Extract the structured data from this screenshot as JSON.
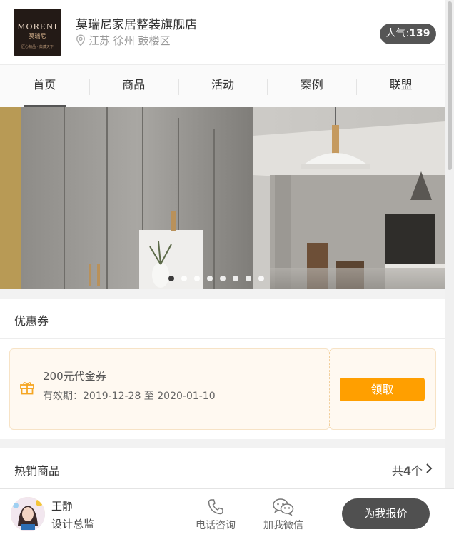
{
  "store": {
    "name": "莫瑞尼家居整装旗舰店",
    "location": "江苏 徐州 鼓楼区",
    "popularity_label": "人气:",
    "popularity_value": "139",
    "logo": {
      "brand": "MORENI",
      "cn": "莫瑞尼",
      "tagline": "匠心精品 · 典藏天下"
    }
  },
  "tabs": [
    {
      "label": "首页",
      "active": true
    },
    {
      "label": "商品",
      "active": false
    },
    {
      "label": "活动",
      "active": false
    },
    {
      "label": "案例",
      "active": false
    },
    {
      "label": "联盟",
      "active": false
    }
  ],
  "banner": {
    "slide_count": 8,
    "active_index": 0
  },
  "coupon_section": {
    "title": "优惠券",
    "coupon": {
      "name": "200元代金券",
      "validity": "有效期：2019-12-28 至 2020-01-10",
      "claim_label": "领取",
      "icon": "gift-icon"
    }
  },
  "hot_products": {
    "title": "热销商品",
    "count_prefix": "共",
    "count": "4",
    "count_suffix": "个",
    "icon": "chevron-right-icon"
  },
  "bottom_bar": {
    "designer_name": "王静",
    "designer_title": "设计总监",
    "phone_label": "电话咨询",
    "wechat_label": "加我微信",
    "quote_label": "为我报价"
  },
  "colors": {
    "accent_orange": "#ff9f00",
    "dark_button": "#505050",
    "coupon_bg": "#fff9f1"
  }
}
